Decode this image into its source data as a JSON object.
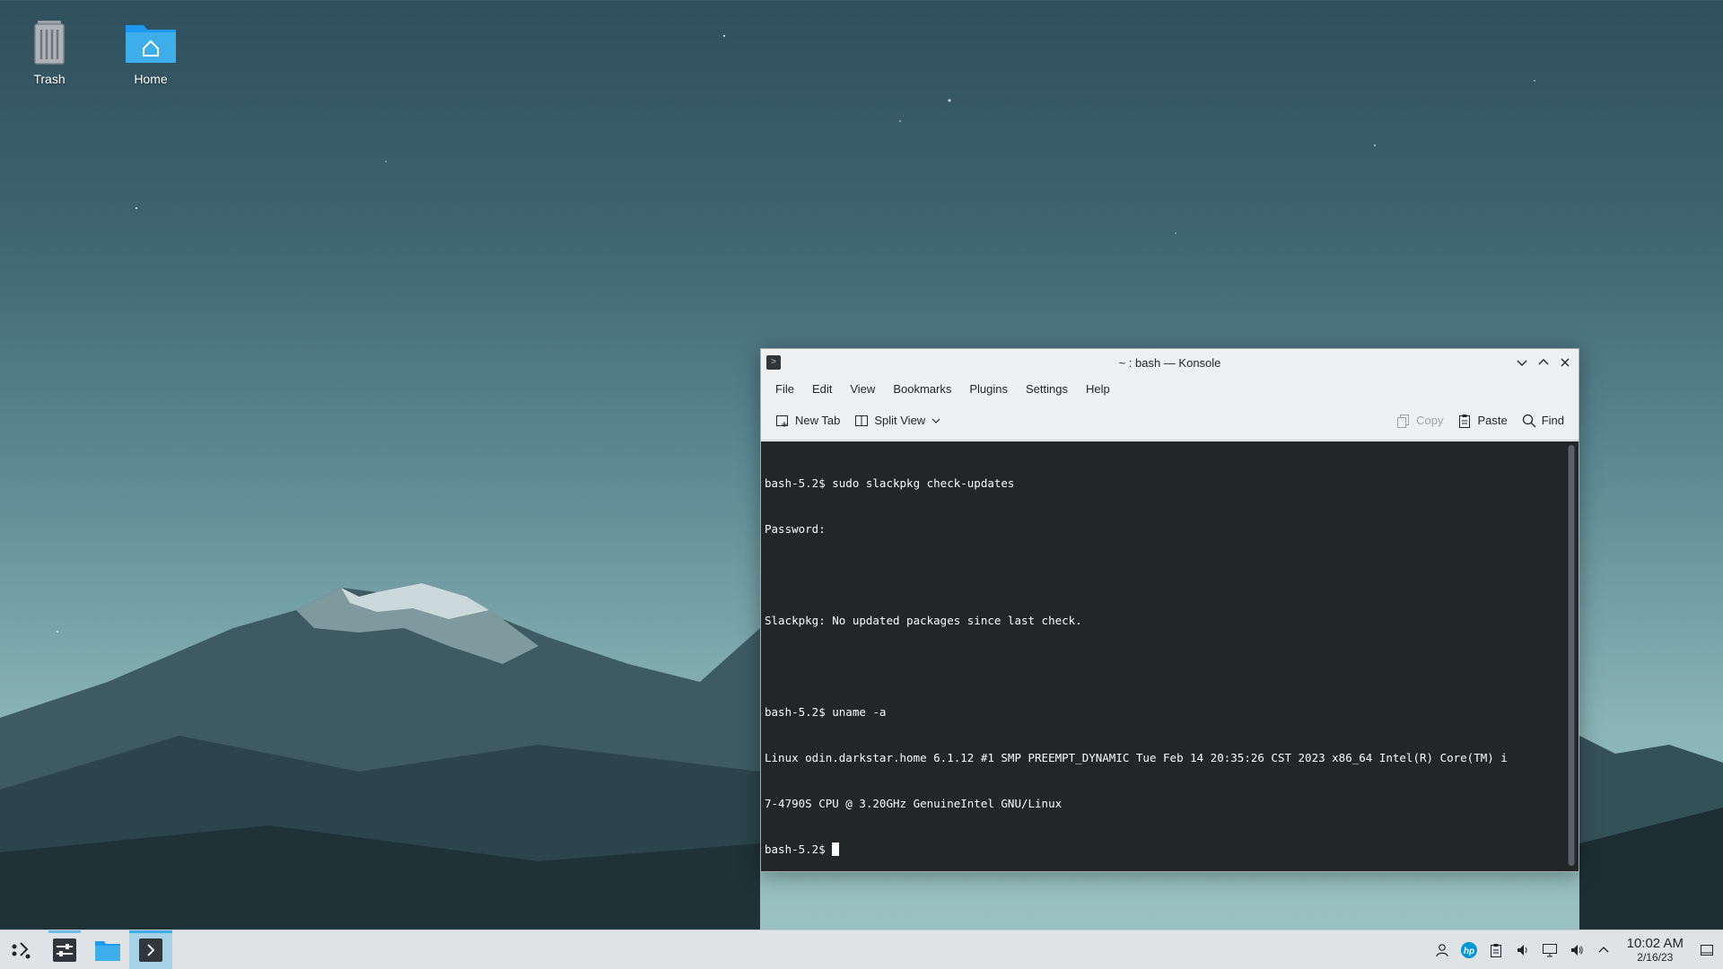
{
  "desktop": {
    "icons": [
      {
        "label": "Trash",
        "icon": "trash-icon"
      },
      {
        "label": "Home",
        "icon": "home-folder-icon"
      }
    ]
  },
  "window": {
    "title": "~ : bash — Konsole",
    "menu": [
      "File",
      "Edit",
      "View",
      "Bookmarks",
      "Plugins",
      "Settings",
      "Help"
    ],
    "toolbar": {
      "new_tab": "New Tab",
      "split_view": "Split View",
      "copy": "Copy",
      "paste": "Paste",
      "find": "Find"
    },
    "terminal_lines": [
      "bash-5.2$ sudo slackpkg check-updates",
      "Password:",
      "",
      "Slackpkg: No updated packages since last check.",
      "",
      "bash-5.2$ uname -a",
      "Linux odin.darkstar.home 6.1.12 #1 SMP PREEMPT_DYNAMIC Tue Feb 14 20:35:26 CST 2023 x86_64 Intel(R) Core(TM) i",
      "7-4790S CPU @ 3.20GHz GenuineIntel GNU/Linux"
    ],
    "prompt": "bash-5.2$ "
  },
  "taskbar": {
    "clock_time": "10:02 AM",
    "clock_date": "2/16/23",
    "colors": {
      "accent": "#3daee9",
      "terminal_bg": "#232627"
    }
  }
}
